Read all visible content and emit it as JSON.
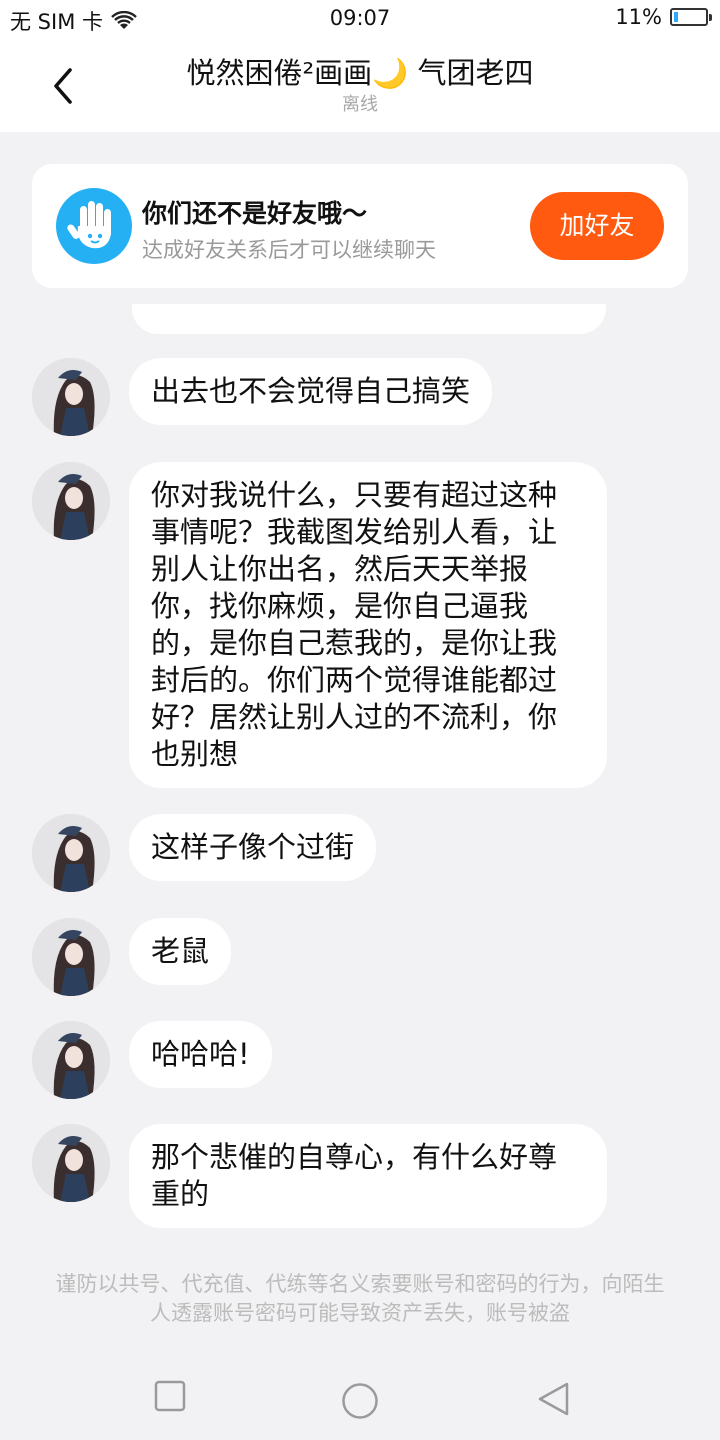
{
  "status_bar": {
    "carrier": "无 SIM 卡",
    "time": "09:07",
    "battery": "11%",
    "battery_level": 0.11
  },
  "header": {
    "title": "悦然困倦²画画🌙 气团老四",
    "status": "离线"
  },
  "notice": {
    "title": "你们还不是好友哦～",
    "description": "达成好友关系后才可以继续聊天",
    "add_button": "加好友"
  },
  "messages": [
    {
      "text": "出去也不会觉得自己搞笑"
    },
    {
      "text": "你对我说什么，只要有超过这种事情呢？我截图发给别人看，让别人让你出名，然后天天举报你，找你麻烦，是你自己逼我的，是你自己惹我的，是你让我封后的。你们两个觉得谁能都过好？居然让别人过的不流利，你也别想"
    },
    {
      "text": "这样子像个过街"
    },
    {
      "text": "老鼠"
    },
    {
      "text": "哈哈哈!"
    },
    {
      "text": "那个悲催的自尊心，有什么好尊重的"
    }
  ],
  "warning": "谨防以共号、代充值、代练等名义索要账号和密码的行为，向陌生人透露账号密码可能导致资产丢失，账号被盗",
  "icons": {
    "wifi": "wifi-icon",
    "battery": "battery-icon",
    "back": "chevron-left-icon",
    "hand": "hand-icon",
    "recent": "square-icon",
    "home": "circle-icon",
    "back_nav": "triangle-icon"
  }
}
